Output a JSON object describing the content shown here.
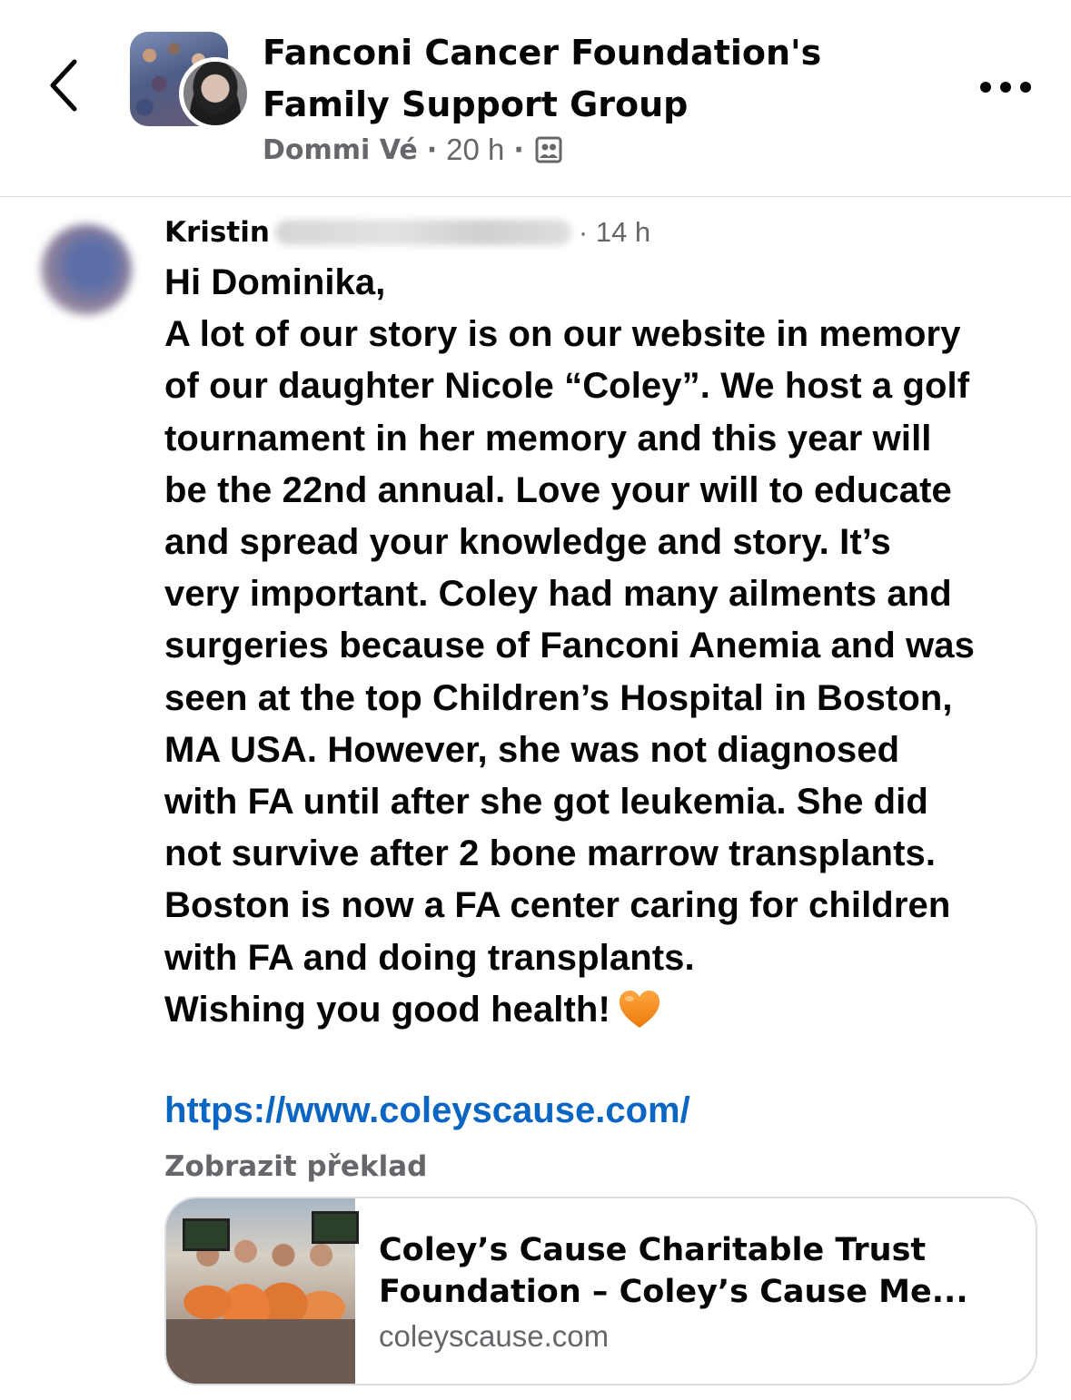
{
  "header": {
    "group_name_line1": "Fanconi Cancer Foundation's",
    "group_name_line2": "Family Support Group",
    "poster_name": "Dommi Vé",
    "separator": "·",
    "time": "20 h",
    "privacy_icon": "group-members-icon",
    "back_icon": "chevron-left-icon",
    "more_icon": "more-dots-icon"
  },
  "comment": {
    "author_name": "Kristin",
    "time": "· 14 h",
    "lines": [
      "Hi Dominika,",
      "A lot of our story is on our website in memory",
      "of our daughter Nicole “Coley”. We host a golf",
      "tournament in her memory and this year will",
      "be the 22nd annual. Love your will to educate",
      "and spread your knowledge and story. It’s",
      "very important. Coley had many ailments and",
      "surgeries because of Fanconi Anemia and was",
      "seen at the top Children’s Hospital in Boston,",
      "MA USA. However, she was not diagnosed",
      "with FA until after she got leukemia. She did",
      "not survive after 2 bone marrow transplants.",
      "Boston is now a FA center caring for children",
      "with FA and doing transplants.",
      "Wishing you good health!"
    ],
    "emoji": "orange-heart-icon",
    "url": "https://www.coleyscause.com/",
    "translate_label": "Zobrazit překlad"
  },
  "link_preview": {
    "title_line1": "Coley’s Cause Charitable Trust",
    "title_line2": "Foundation – Coley’s Cause Me...",
    "domain": "coleyscause.com"
  },
  "colors": {
    "text": "#050505",
    "secondary_text": "#65676b",
    "link": "#0a66c2",
    "heart": "#f28a1e",
    "divider": "#d9d9dc"
  }
}
